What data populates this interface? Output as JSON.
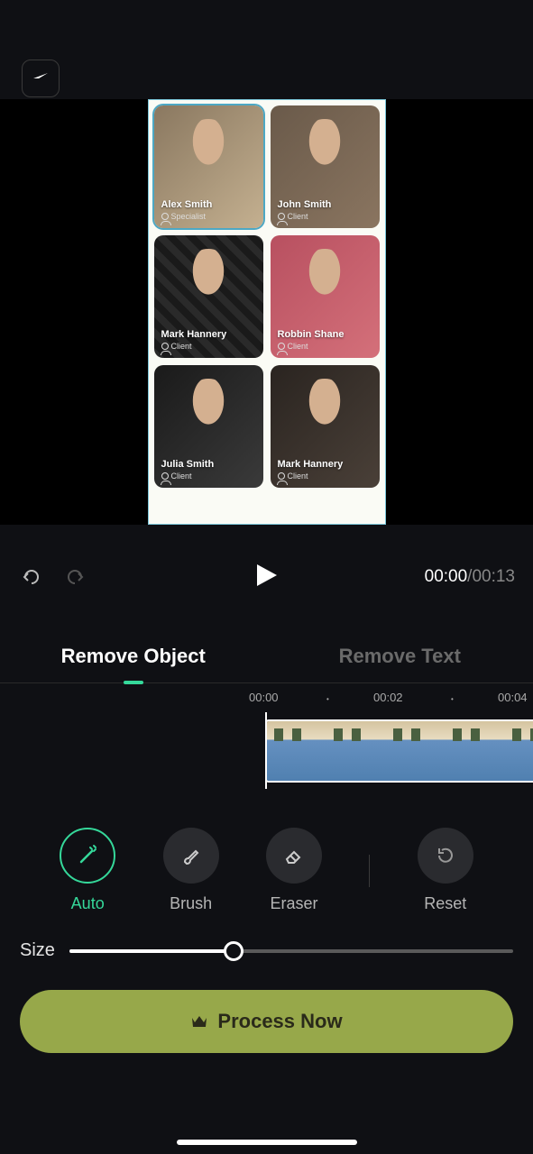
{
  "playback": {
    "current_time": "00:00",
    "total_time": "00:13"
  },
  "tabs": {
    "remove_object": "Remove Object",
    "remove_text": "Remove Text"
  },
  "timeline": {
    "marks": [
      "00:00",
      "00:02",
      "00:04"
    ]
  },
  "tools": {
    "auto": "Auto",
    "brush": "Brush",
    "eraser": "Eraser",
    "reset": "Reset"
  },
  "size": {
    "label": "Size",
    "value": 37
  },
  "process_button": "Process Now",
  "canvas": {
    "profiles": [
      {
        "name": "Alex Smith",
        "role": "Specialist",
        "selected": true
      },
      {
        "name": "John Smith",
        "role": "Client",
        "selected": false
      },
      {
        "name": "Mark Hannery",
        "role": "Client",
        "selected": false
      },
      {
        "name": "Robbin Shane",
        "role": "Client",
        "selected": false
      },
      {
        "name": "Julia Smith",
        "role": "Client",
        "selected": false
      },
      {
        "name": "Mark Hannery",
        "role": "Client",
        "selected": false
      }
    ]
  },
  "colors": {
    "accent": "#35d89a",
    "process": "#97a84a"
  }
}
